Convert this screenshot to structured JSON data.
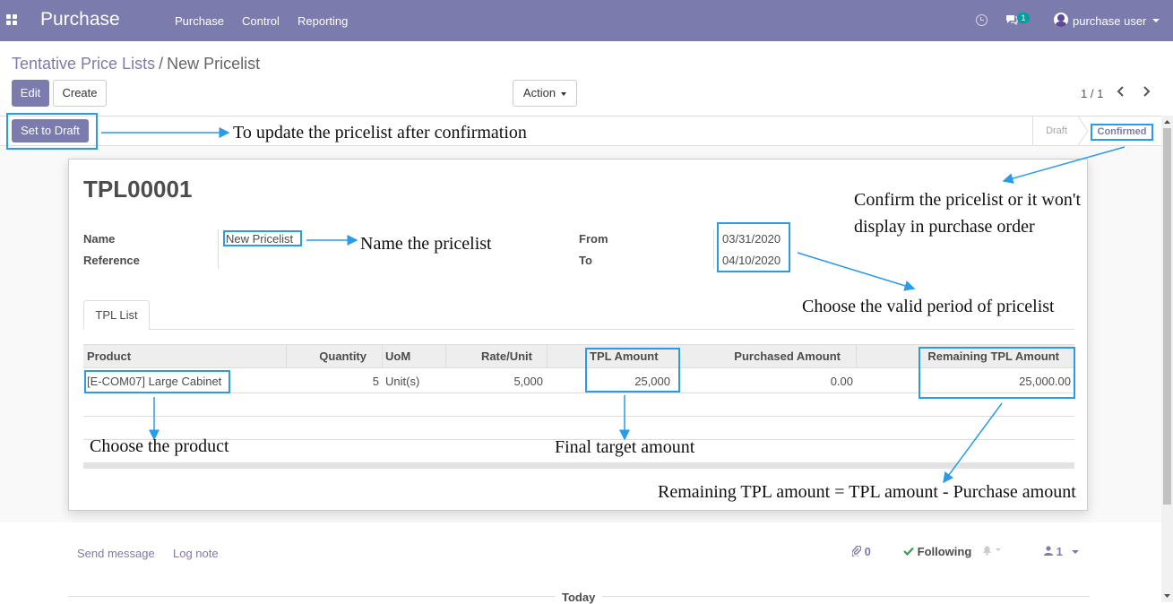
{
  "navbar": {
    "app_title": "Purchase",
    "menu": [
      "Purchase",
      "Control",
      "Reporting"
    ],
    "chat_badge": "1",
    "user": "purchase user"
  },
  "breadcrumb": {
    "parent": "Tentative Price Lists",
    "separator": "/",
    "current": "New Pricelist"
  },
  "buttons": {
    "edit": "Edit",
    "create": "Create",
    "action": "Action",
    "set_to_draft": "Set to Draft"
  },
  "pager": {
    "value": "1 / 1"
  },
  "status": {
    "draft": "Draft",
    "confirmed": "Confirmed",
    "active": "Confirmed"
  },
  "record": {
    "title": "TPL00001",
    "name_label": "Name",
    "name_value": "New Pricelist",
    "reference_label": "Reference",
    "reference_value": "",
    "from_label": "From",
    "from_value": "03/31/2020",
    "to_label": "To",
    "to_value": "04/10/2020"
  },
  "tabs": [
    "TPL List"
  ],
  "table": {
    "columns": [
      "Product",
      "Quantity",
      "UoM",
      "Rate/Unit",
      "TPL Amount",
      "Purchased Amount",
      "Remaining TPL Amount"
    ],
    "rows": [
      {
        "product": "[E-COM07] Large Cabinet",
        "quantity": "5",
        "uom": "Unit(s)",
        "rate": "5,000",
        "tpl_amount": "25,000",
        "purchased": "0.00",
        "remaining": "25,000.00"
      }
    ]
  },
  "chatter": {
    "send_message": "Send message",
    "log_note": "Log note",
    "attachments": "0",
    "following": "Following",
    "followers": "1",
    "today": "Today"
  },
  "annotations": {
    "set_draft": "To update the pricelist after confirmation",
    "confirm": "Confirm the pricelist or it won't display in purchase order",
    "name": "Name the pricelist",
    "period": "Choose the valid period of pricelist",
    "product": "Choose the product",
    "tpl_amount": "Final target amount",
    "remaining": "Remaining TPL amount = TPL amount - Purchase amount"
  },
  "colors": {
    "brand": "#7c7bad",
    "annotation": "#2a9be8",
    "badge": "#00a09d"
  }
}
